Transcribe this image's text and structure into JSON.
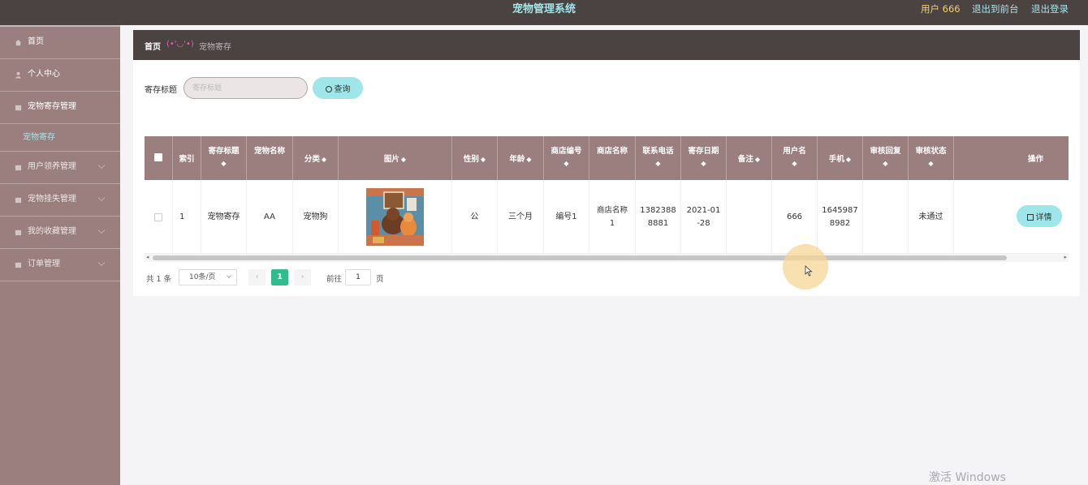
{
  "app": {
    "title": "宠物管理系统",
    "user_label": "用户 666",
    "front_link": "退出到前台",
    "logout_link": "退出登录"
  },
  "sidebar": {
    "items": [
      {
        "label": "首页",
        "icon": "home-icon"
      },
      {
        "label": "个人中心",
        "icon": "user-icon"
      },
      {
        "label": "宠物寄存管理",
        "icon": "folder-icon"
      },
      {
        "label": "宠物寄存",
        "sub": true,
        "active": true
      },
      {
        "label": "用户领养管理",
        "icon": "folder-icon"
      },
      {
        "label": "宠物挂失管理",
        "icon": "folder-icon"
      },
      {
        "label": "我的收藏管理",
        "icon": "folder-icon"
      },
      {
        "label": "订单管理",
        "icon": "folder-icon"
      }
    ]
  },
  "breadcrumb": {
    "home": "首页",
    "separator": "(•'◡'•)",
    "current": "宠物寄存"
  },
  "search": {
    "label": "寄存标题",
    "placeholder": "寄存标题",
    "button": "查询"
  },
  "table": {
    "headers": {
      "index": "索引",
      "title": "寄存标题",
      "pet_name": "宠物名称",
      "category": "分类",
      "image": "图片",
      "gender": "性别",
      "age": "年龄",
      "shop_no": "商店编号",
      "shop_name": "商店名称",
      "phone": "联系电话",
      "date": "寄存日期",
      "remark": "备注",
      "username": "用户名",
      "mobile": "手机",
      "reply": "审核回复",
      "status": "审核状态",
      "action": "操作"
    },
    "sort_glyph": "◆",
    "rows": [
      {
        "index": "1",
        "title": "宠物寄存",
        "pet_name": "AA",
        "category": "宠物狗",
        "gender": "公",
        "age": "三个月",
        "shop_no": "编号1",
        "shop_name_l1": "商店名称",
        "shop_name_l2": "1",
        "phone_l1": "1382388",
        "phone_l2": "8881",
        "date_l1": "2021-01",
        "date_l2": "-28",
        "remark": "",
        "username": "666",
        "mobile_l1": "1645987",
        "mobile_l2": "8982",
        "reply": "",
        "status": "未通过",
        "detail_button": "详情"
      }
    ]
  },
  "pagination": {
    "total": "共 1 条",
    "page_size": "10条/页",
    "prev": "‹",
    "current_page": "1",
    "next": "›",
    "goto_label": "前往",
    "goto_value": "1",
    "page_suffix": "页"
  },
  "watermark": "激活 Windows",
  "colors": {
    "header_bg": "#4a4342",
    "sidebar_bg": "#9b7f7e",
    "accent": "#9ee6ea",
    "user_text": "#f2d166",
    "active_page": "#2fbd8f"
  }
}
